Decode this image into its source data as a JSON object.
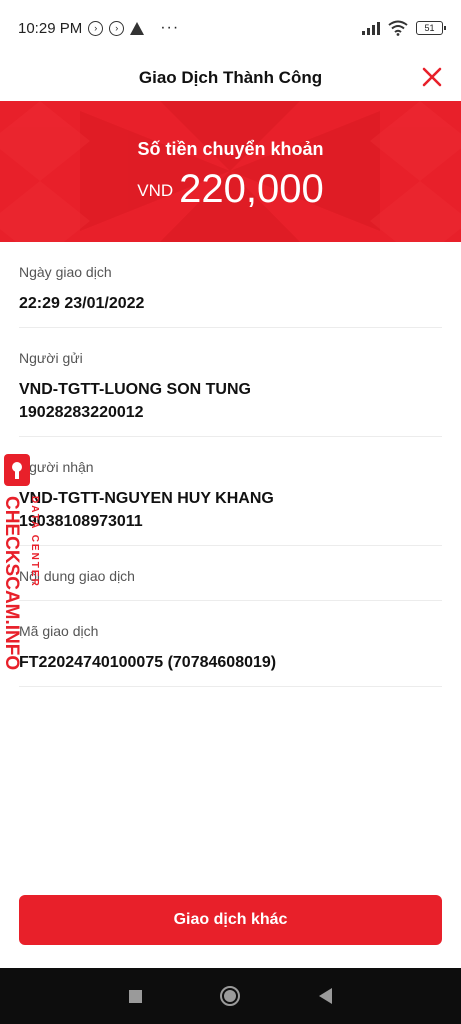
{
  "status_bar": {
    "time": "10:29 PM",
    "more": "···",
    "battery": "51"
  },
  "header": {
    "title": "Giao Dịch Thành Công"
  },
  "banner": {
    "label": "Số tiền chuyển khoản",
    "currency": "VND",
    "amount": "220,000"
  },
  "details": [
    {
      "label": "Ngày giao dịch",
      "values": [
        "22:29 23/01/2022"
      ]
    },
    {
      "label": "Người gửi",
      "values": [
        "VND-TGTT-LUONG SON TUNG",
        "19028283220012"
      ]
    },
    {
      "label": "Người nhận",
      "values": [
        "VND-TGTT-NGUYEN HUY KHANG",
        "19038108973011"
      ]
    },
    {
      "label": "Nội dung giao dịch",
      "values": []
    },
    {
      "label": "Mã giao dịch",
      "values": [
        "FT22024740100075 (70784608019)"
      ]
    }
  ],
  "watermark": {
    "site": "CHECKSCAM.INFO",
    "tag": "DATA CENTER"
  },
  "action": {
    "label": "Giao dịch khác"
  },
  "colors": {
    "brand": "#e8202a",
    "nav": "#0d0d0d"
  }
}
